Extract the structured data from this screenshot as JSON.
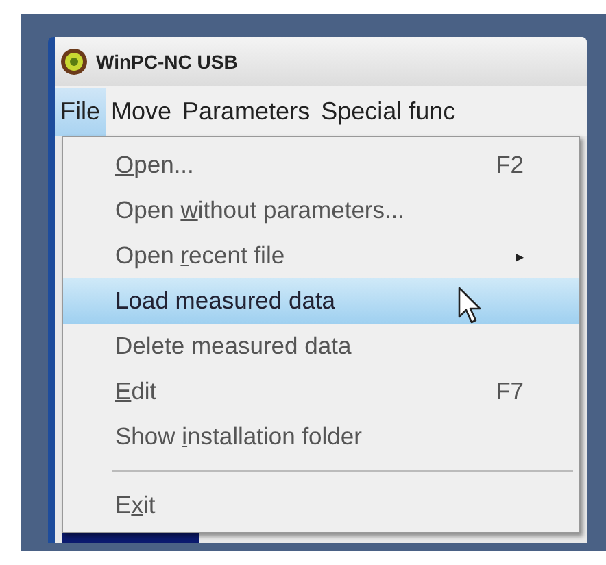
{
  "window": {
    "title": "WinPC-NC USB"
  },
  "menu_bar": [
    {
      "label": "File",
      "selected": true
    },
    {
      "label": "Move",
      "selected": false
    },
    {
      "label": "Parameters",
      "selected": false
    },
    {
      "label": "Special func",
      "selected": false
    }
  ],
  "file_menu": [
    {
      "kind": "item",
      "label": {
        "key": "O",
        "after": "pen..."
      },
      "shortcut": "F2",
      "selected": false
    },
    {
      "kind": "item",
      "label": {
        "before": "Open ",
        "key": "w",
        "after": "ithout parameters..."
      },
      "selected": false
    },
    {
      "kind": "submenu",
      "label": {
        "before": "Open ",
        "key": "r",
        "after": "ecent file"
      },
      "arrow": "▸",
      "selected": false
    },
    {
      "kind": "item",
      "label": {
        "before": "Load measured data"
      },
      "selected": true
    },
    {
      "kind": "item",
      "label": {
        "before": "Delete measured data"
      },
      "selected": false
    },
    {
      "kind": "item",
      "label": {
        "key": "E",
        "after": "dit"
      },
      "shortcut": "F7",
      "selected": false
    },
    {
      "kind": "item",
      "label": {
        "before": "Show ",
        "key": "i",
        "after": "nstallation folder"
      },
      "selected": false
    },
    {
      "kind": "separator"
    },
    {
      "kind": "item",
      "label": {
        "before": "E",
        "key": "x",
        "after": "it"
      },
      "selected": false
    }
  ]
}
